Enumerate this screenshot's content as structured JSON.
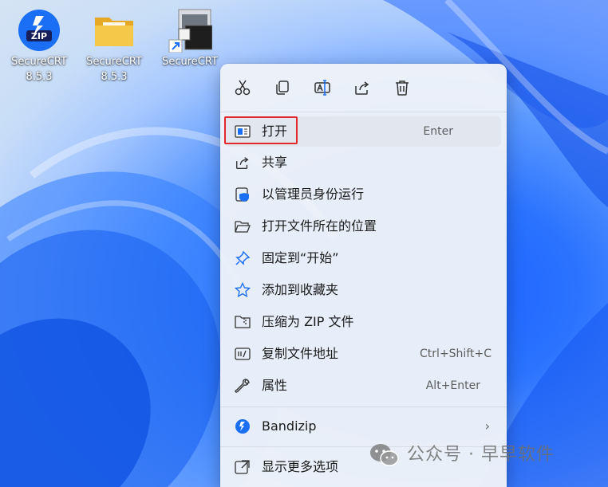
{
  "desktop": {
    "icons": [
      {
        "label": "SecureCRT\n8.5.3",
        "icon": "zip-archive-icon"
      },
      {
        "label": "SecureCRT\n8.5.3",
        "icon": "folder-icon"
      },
      {
        "label": "SecureCRT",
        "icon": "securecrt-shortcut-icon"
      }
    ]
  },
  "context_menu": {
    "toolbar": [
      {
        "icon": "cut-icon"
      },
      {
        "icon": "copy-icon"
      },
      {
        "icon": "rename-icon"
      },
      {
        "icon": "share-icon"
      },
      {
        "icon": "delete-icon"
      }
    ],
    "items": [
      {
        "label": "打开",
        "shortcut": "Enter",
        "icon": "open-window-icon"
      },
      {
        "label": "共享",
        "shortcut": "",
        "icon": "share-icon"
      },
      {
        "label": "以管理员身份运行",
        "shortcut": "",
        "icon": "shield-icon"
      },
      {
        "label": "打开文件所在的位置",
        "shortcut": "",
        "icon": "folder-open-icon"
      },
      {
        "label": "固定到“开始”",
        "shortcut": "",
        "icon": "pin-icon"
      },
      {
        "label": "添加到收藏夹",
        "shortcut": "",
        "icon": "star-icon"
      },
      {
        "label": "压缩为 ZIP 文件",
        "shortcut": "",
        "icon": "zip-folder-icon"
      },
      {
        "label": "复制文件地址",
        "shortcut": "Ctrl+Shift+C",
        "icon": "copy-path-icon"
      },
      {
        "label": "属性",
        "shortcut": "Alt+Enter",
        "icon": "wrench-icon"
      },
      {
        "label": "Bandizip",
        "shortcut": "",
        "icon": "bandizip-icon",
        "submenu": "›"
      },
      {
        "label": "显示更多选项",
        "shortcut": "",
        "icon": "more-options-icon"
      }
    ]
  },
  "watermark": {
    "text": "公众号 · 早早软件",
    "icon": "wechat-icon"
  },
  "colors": {
    "highlight_box": "#e0282d",
    "accent": "#1b6ff5"
  }
}
